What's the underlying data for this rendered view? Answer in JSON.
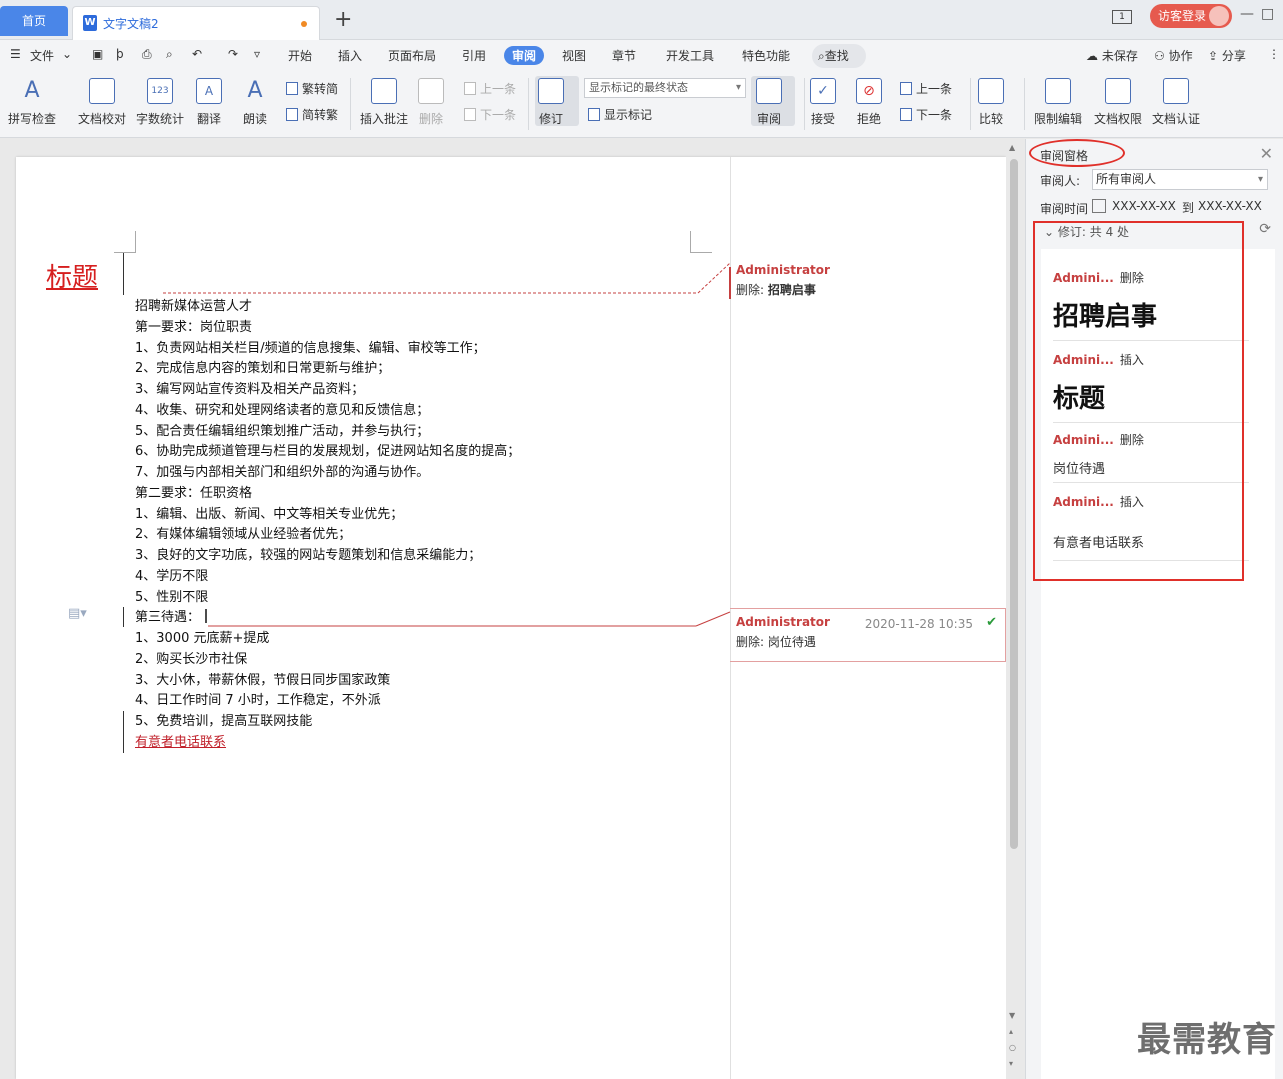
{
  "tabs": {
    "home": "首页",
    "doc_title": "文字文稿2",
    "add": "+"
  },
  "titlebar": {
    "window_icon": "1",
    "login": "访客登录"
  },
  "menu": {
    "file": "文件",
    "items": [
      "开始",
      "插入",
      "页面布局",
      "引用",
      "审阅",
      "视图",
      "章节",
      "开发工具",
      "特色功能"
    ],
    "active": "审阅",
    "search": "查找",
    "right": {
      "unsaved": "未保存",
      "collab": "协作",
      "share": "分享"
    }
  },
  "ribbon": {
    "spell": "拼写检查",
    "proof": "文档校对",
    "wordcount": "字数统计",
    "translate": "翻译",
    "read": "朗读",
    "trad_simp": "繁转简",
    "simp_trad": "简转繁",
    "insert_comment": "插入批注",
    "delete": "删除",
    "prev": "上一条",
    "next": "下一条",
    "track": "修订",
    "markup_select": "显示标记的最终状态",
    "show_markup": "显示标记",
    "review": "审阅",
    "accept": "接受",
    "reject": "拒绝",
    "prev2": "上一条",
    "next2": "下一条",
    "compare": "比较",
    "restrict": "限制编辑",
    "permission": "文档权限",
    "certify": "文档认证"
  },
  "document": {
    "title": "标题",
    "lines": [
      "招聘新媒体运营人才",
      "第一要求：岗位职责",
      "1、负责网站相关栏目/频道的信息搜集、编辑、审校等工作；",
      "2、完成信息内容的策划和日常更新与维护；",
      "3、编写网站宣传资料及相关产品资料；",
      "4、收集、研究和处理网络读者的意见和反馈信息；",
      "5、配合责任编辑组织策划推广活动，并参与执行；",
      "6、协助完成频道管理与栏目的发展规划，促进网站知名度的提高；",
      "7、加强与内部相关部门和组织外部的沟通与协作。",
      "第二要求：任职资格",
      "1、编辑、出版、新闻、中文等相关专业优先；",
      "2、有媒体编辑领域从业经验者优先；",
      "3、良好的文字功底，较强的网站专题策划和信息采编能力；",
      "4、学历不限",
      "5、性别不限",
      "第三待遇：",
      "1、3000 元底薪+提成",
      "2、购买长沙市社保",
      "3、大小休，带薪休假，节假日同步国家政策",
      "4、日工作时间 7 小时，工作稳定，不外派",
      "5、免费培训，提高互联网技能"
    ],
    "inserted_line": "有意者电话联系",
    "balloons": [
      {
        "author": "Administrator",
        "text_prefix": "删除:",
        "text": "招聘启事",
        "time": ""
      },
      {
        "author": "Administrator",
        "text_prefix": "删除:",
        "text": "岗位待遇",
        "time": "2020-11-28 10:35"
      }
    ]
  },
  "review_pane": {
    "title": "审阅窗格",
    "reviewer_label": "审阅人:",
    "reviewer_value": "所有审阅人",
    "time_label": "审阅时间",
    "date_from": "XXX-XX-XX",
    "date_to_label": "到",
    "date_to": "XXX-XX-XX",
    "revisions_header": "修订:  共 4 处",
    "revisions": [
      {
        "author": "Admini...",
        "op": "删除",
        "content": "招聘启事",
        "style": "big"
      },
      {
        "author": "Admini...",
        "op": "插入",
        "content": "标题",
        "style": "big"
      },
      {
        "author": "Admini...",
        "op": "删除",
        "content": "岗位待遇",
        "style": "small"
      },
      {
        "author": "Admini...",
        "op": "插入",
        "content": "有意者电话联系",
        "style": "small"
      }
    ]
  },
  "watermark": "最需教育",
  "colors": {
    "accent": "#4a86e8",
    "revision_red": "#c64040",
    "highlight_red": "#e0302a"
  }
}
